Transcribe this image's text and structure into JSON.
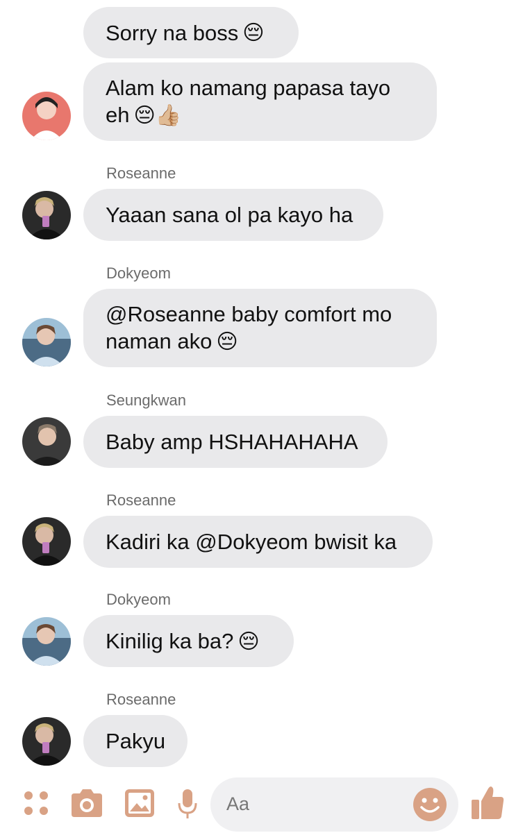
{
  "messages": [
    {
      "sender": "",
      "text": "Sorry na boss",
      "emoji": "😔"
    },
    {
      "sender": "",
      "text": "Alam ko namang papasa tayo\neh",
      "emoji": "😔👍🏼"
    },
    {
      "sender": "Roseanne",
      "text": "Yaaan sana ol pa kayo ha",
      "emoji": ""
    },
    {
      "sender": "Dokyeom",
      "text": "@Roseanne baby comfort mo\nnaman ako",
      "emoji": "😔"
    },
    {
      "sender": "Seungkwan",
      "text": "Baby amp HSHAHAHAHA",
      "emoji": ""
    },
    {
      "sender": "Roseanne",
      "text": "Kadiri ka @Dokyeom bwisit ka",
      "emoji": ""
    },
    {
      "sender": "Dokyeom",
      "text": "Kinilig ka ba?",
      "emoji": "😔"
    },
    {
      "sender": "Roseanne",
      "text": "Pakyu",
      "emoji": ""
    }
  ],
  "composer": {
    "placeholder": "Aa",
    "icons": [
      "apps-icon",
      "camera-icon",
      "gallery-icon",
      "microphone-icon",
      "emoji-icon",
      "thumbs-up-icon"
    ],
    "accent_color": "#d9a285"
  },
  "colors": {
    "bubble": "#e9e9eb",
    "sender_name": "#6b6b6b"
  }
}
